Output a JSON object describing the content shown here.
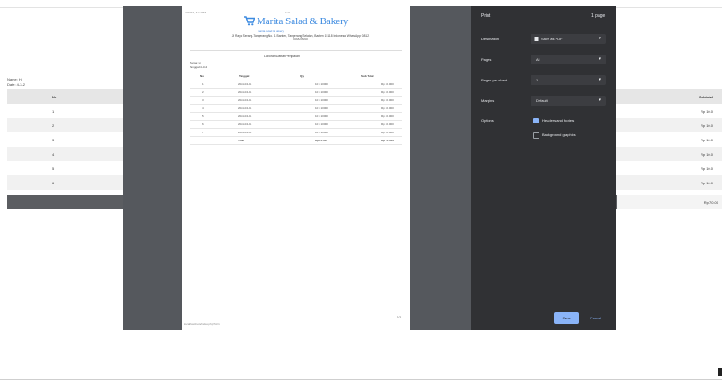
{
  "background": {
    "info_lines": [
      "Name: Hi",
      "Date: 4-3-2"
    ],
    "table_header": [
      "No",
      "Subtotal"
    ],
    "rows": [
      {
        "no": "1",
        "amount": "Rp 10.0"
      },
      {
        "no": "2",
        "amount": "Rp 10.0"
      },
      {
        "no": "3",
        "amount": "Rp 10.0"
      },
      {
        "no": "4",
        "amount": "Rp 10.0"
      },
      {
        "no": "5",
        "amount": "Rp 10.0"
      },
      {
        "no": "6",
        "amount": "Rp 10.0"
      }
    ],
    "total": "Rp 70.00"
  },
  "preview": {
    "date_text": "4/13/24, 4:15 PM",
    "page_name": "Nota",
    "logo": "Marita Salad & Bakery",
    "logo_sub": "marita salad & bakery",
    "address": "Jl. Raya Serang-Tangerang No. 1, Banten, Tangerang Selatan, Banten 15118 Indonesia WhatsApp: 0812-0000-0000",
    "title": "Laporan Daftar Penjualan",
    "info_lines": [
      "Nama: Hi",
      "Tanggal: 4-3-2"
    ],
    "columns": [
      "No",
      "Tanggal",
      "Qty",
      "Sub Total"
    ],
    "rows": [
      [
        "1",
        "2024-04-04",
        "10 x 10000",
        "Rp 10.000"
      ],
      [
        "2",
        "2024-04-04",
        "10 x 10000",
        "Rp 10.000"
      ],
      [
        "3",
        "2024-04-04",
        "10 x 10000",
        "Rp 10.000"
      ],
      [
        "4",
        "2024-04-04",
        "10 x 10000",
        "Rp 10.000"
      ],
      [
        "5",
        "2024-04-04",
        "10 x 10000",
        "Rp 10.000"
      ],
      [
        "6",
        "2024-04-04",
        "10 x 10000",
        "Rp 10.000"
      ],
      [
        "7",
        "2024-04-04",
        "10 x 10000",
        "Rp 10.000"
      ]
    ],
    "total_row": [
      "",
      "Total",
      "Rp 70.000",
      "Rp 70.000"
    ],
    "footer_url": "localhost/nota/index.php?id=1",
    "page_num": "1/1"
  },
  "print_panel": {
    "title": "Print",
    "sheet_count": "1 page",
    "settings": [
      {
        "label": "Destination",
        "value": "Save as PDF"
      },
      {
        "label": "Pages",
        "value": "All"
      },
      {
        "label": "Pages per sheet",
        "value": "1"
      },
      {
        "label": "Margins",
        "value": "Default"
      }
    ],
    "options_label": "Options",
    "options": [
      {
        "label": "Headers and footers",
        "checked": true
      },
      {
        "label": "Background graphics",
        "checked": false
      }
    ],
    "save_label": "Save",
    "cancel_label": "Cancel"
  },
  "colors": {
    "accent": "#8ab4f8",
    "panel_bg": "#303134",
    "overlay_bg": "#55585d",
    "logo_blue": "#3c8ae0"
  }
}
